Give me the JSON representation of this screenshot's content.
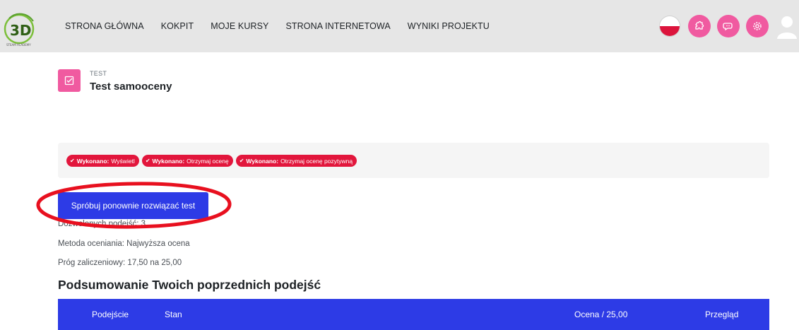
{
  "navbar": {
    "items": [
      {
        "label": "STRONA GŁÓWNA"
      },
      {
        "label": "KOKPIT"
      },
      {
        "label": "MOJE KURSY"
      },
      {
        "label": "STRONA INTERNETOWA"
      },
      {
        "label": "WYNIKI PROJEKTU"
      }
    ],
    "icons": [
      "poland-flag-icon",
      "puzzle-icon",
      "chat-icon",
      "gear-icon",
      "user-icon"
    ],
    "accent_color": "#f05aa0"
  },
  "activity": {
    "type_label": "TEST",
    "title": "Test samooceny"
  },
  "completion": {
    "badges": [
      {
        "prefix": "Wykonano:",
        "text": "Wyświetl"
      },
      {
        "prefix": "Wykonano:",
        "text": "Otrzymaj ocenę"
      },
      {
        "prefix": "Wykonano:",
        "text": "Otrzymaj ocenę pozytywną"
      }
    ],
    "badge_color": "#e2163c"
  },
  "quiz": {
    "retry_label": "Spróbuj ponownie rozwiązać test",
    "attempts_allowed": "Dozwolonych podejść: 3",
    "grading_method": "Metoda oceniania: Najwyższa ocena",
    "pass_threshold": "Próg zaliczeniowy: 17,50 na 25,00"
  },
  "summary": {
    "heading": "Podsumowanie Twoich poprzednich podejść",
    "columns": [
      "Podejście",
      "Stan",
      "Ocena / 25,00",
      "Przegląd"
    ],
    "header_color": "#2d3be6"
  }
}
